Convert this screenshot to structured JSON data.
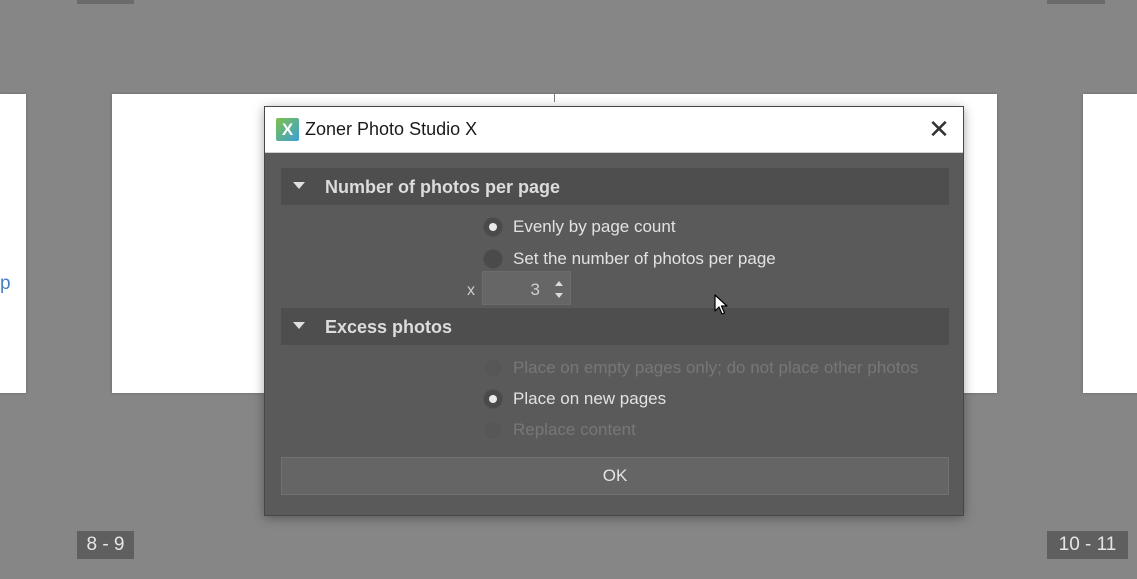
{
  "window": {
    "title": "Zoner Photo Studio X",
    "app_icon_letter": "X",
    "close_glyph": "✕"
  },
  "background": {
    "left_edge_text": "p",
    "left_page_badge": "8 - 9",
    "right_page_badge": "10 - 11"
  },
  "sections": [
    {
      "title": "Number of photos per page",
      "options": [
        {
          "label": "Evenly by page count",
          "selected": true,
          "enabled": true
        },
        {
          "label": "Set the number of photos per page",
          "selected": false,
          "enabled": true
        }
      ],
      "spinner": {
        "prefix": "x",
        "value": "3"
      }
    },
    {
      "title": "Excess photos",
      "options": [
        {
          "label": "Place on empty pages only; do not place other photos",
          "selected": false,
          "enabled": false
        },
        {
          "label": "Place on new pages",
          "selected": true,
          "enabled": true
        },
        {
          "label": "Replace content",
          "selected": false,
          "enabled": false
        }
      ]
    }
  ],
  "ok_label": "OK",
  "icons": {
    "close": "close-icon",
    "collapse": "triangle-down-icon",
    "spinner_up": "arrow-up-icon",
    "spinner_down": "arrow-down-icon",
    "cursor": "mouse-pointer-icon"
  },
  "colors": {
    "backdrop": "#868686",
    "dialog_bg": "#5a5a5a",
    "section_header_bg": "#4e4e4e",
    "link_text": "#4a7fc0"
  }
}
